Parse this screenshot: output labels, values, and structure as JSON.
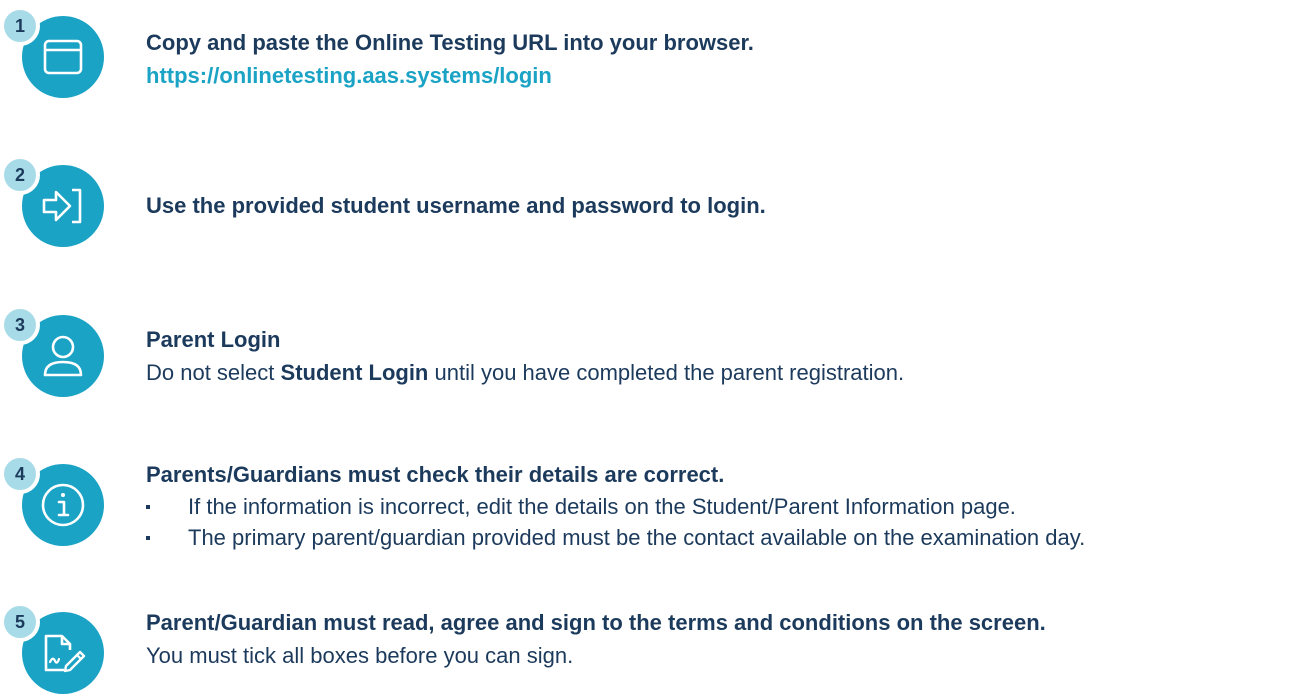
{
  "steps": [
    {
      "number": "1",
      "icon": "browser-window-icon",
      "title": "Copy and paste the Online Testing URL into your browser.",
      "link": "https://onlinetesting.aas.systems/login"
    },
    {
      "number": "2",
      "icon": "login-arrow-icon",
      "title": "Use the provided student username and password to login."
    },
    {
      "number": "3",
      "icon": "user-icon",
      "title": "Parent Login",
      "body_prefix": "Do not select ",
      "body_bold": "Student Login",
      "body_suffix": " until you have completed the parent registration."
    },
    {
      "number": "4",
      "icon": "info-icon",
      "title": "Parents/Guardians must check their details are correct.",
      "bullets": [
        "If the information is incorrect, edit the details on the Student/Parent Information page.",
        "The primary parent/guardian provided must be the contact available on the examination day."
      ]
    },
    {
      "number": "5",
      "icon": "sign-document-icon",
      "title": "Parent/Guardian must read, agree and sign to the terms and conditions on the screen.",
      "body": "You must tick all boxes before you can sign."
    }
  ],
  "colors": {
    "icon_circle": "#1aa3c4",
    "badge": "#a8dbe8",
    "text": "#1c3a5c",
    "link": "#1aa3c4"
  }
}
